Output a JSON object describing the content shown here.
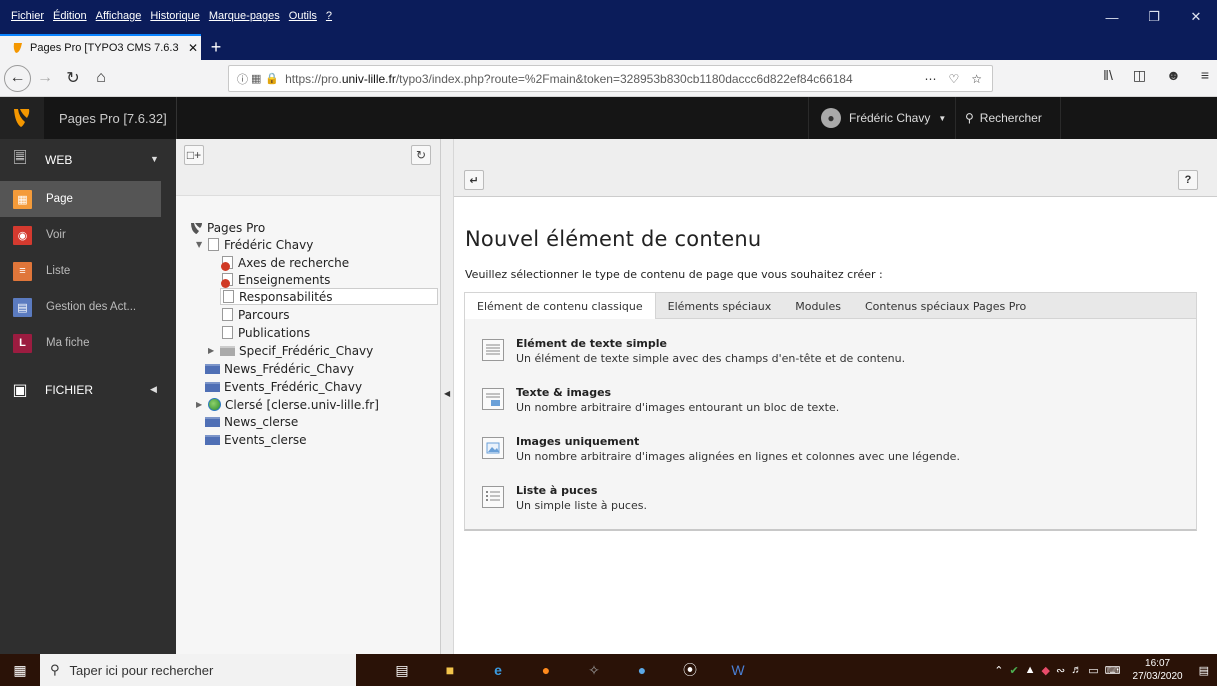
{
  "browser": {
    "menu": [
      "Fichier",
      "Édition",
      "Affichage",
      "Historique",
      "Marque-pages",
      "Outils",
      "?"
    ],
    "tab_title": "Pages Pro [TYPO3 CMS 7.6.32]",
    "url_prefix": "https://pro.",
    "url_domain": "univ-lille.fr",
    "url_rest": "/typo3/index.php?route=%2Fmain&token=328953b830cb1180daccc6d822ef84c66184"
  },
  "typo3": {
    "site_name": "Pages Pro [7.6.32]",
    "user_name": "Frédéric Chavy",
    "search_label": "Rechercher",
    "modules": {
      "web_group": "WEB",
      "items": [
        {
          "label": "Page",
          "color": "#f49b3a",
          "icon": "page-module-icon"
        },
        {
          "label": "Voir",
          "color": "#d43a2f",
          "icon": "view-module-icon"
        },
        {
          "label": "Liste",
          "color": "#e0763a",
          "icon": "list-module-icon"
        },
        {
          "label": "Gestion des Act...",
          "color": "#5b7bc0",
          "icon": "news-module-icon"
        },
        {
          "label": "Ma fiche",
          "color": "#9b1c40",
          "icon": "profile-module-icon"
        }
      ],
      "file_group": "FICHIER"
    },
    "tree": {
      "root": "Pages Pro",
      "nodes": [
        "Frédéric Chavy",
        "Axes de recherche",
        "Enseignements",
        "Responsabilités",
        "Parcours",
        "Publications",
        "Specif_Frédéric_Chavy",
        "News_Frédéric_Chavy",
        "Events_Frédéric_Chavy",
        "Clersé [clerse.univ-lille.fr]",
        "News_clerse",
        "Events_clerse"
      ]
    },
    "content": {
      "title": "Nouvel élément de contenu",
      "intro": "Veuillez sélectionner le type de contenu de page que vous souhaitez créer :",
      "tabs": [
        "Elément de contenu classique",
        "Eléments spéciaux",
        "Modules",
        "Contenus spéciaux Pages Pro"
      ],
      "wizards": [
        {
          "title": "Elément de texte simple",
          "desc": "Un élément de texte simple avec des champs d'en-tête et de contenu."
        },
        {
          "title": "Texte & images",
          "desc": "Un nombre arbitraire d'images entourant un bloc de texte."
        },
        {
          "title": "Images uniquement",
          "desc": "Un nombre arbitraire d'images alignées en lignes et colonnes avec une légende."
        },
        {
          "title": "Liste à puces",
          "desc": "Un simple liste à puces."
        }
      ],
      "help_label": "?"
    }
  },
  "taskbar": {
    "search_placeholder": "Taper ici pour rechercher",
    "time": "16:07",
    "date": "27/03/2020"
  }
}
